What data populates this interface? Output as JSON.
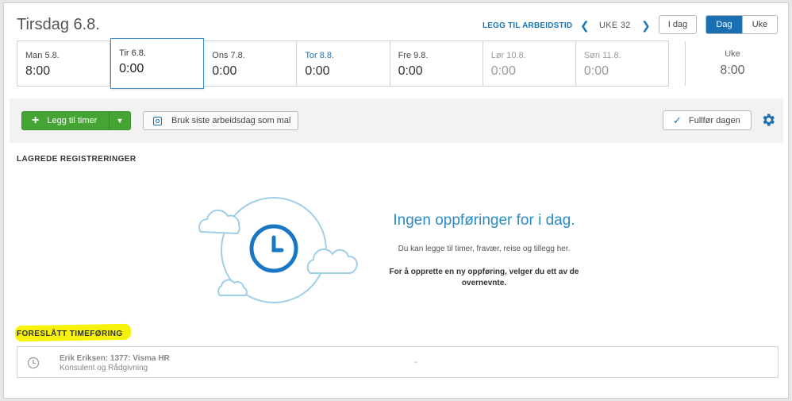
{
  "header": {
    "date_title": "Tirsdag 6.8.",
    "add_worktime": "LEGG TIL ARBEIDSTID",
    "week_label": "UKE 32",
    "today_button": "I dag",
    "view_day": "Dag",
    "view_week": "Uke"
  },
  "days": [
    {
      "name": "Man 5.8.",
      "time": "8:00"
    },
    {
      "name": "Tir 6.8.",
      "time": "0:00"
    },
    {
      "name": "Ons 7.8.",
      "time": "0:00"
    },
    {
      "name": "Tor 8.8.",
      "time": "0:00"
    },
    {
      "name": "Fre 9.8.",
      "time": "0:00"
    },
    {
      "name": "Lør 10.8.",
      "time": "0:00"
    },
    {
      "name": "Søn 11.8.",
      "time": "0:00"
    }
  ],
  "week_total": {
    "label": "Uke",
    "value": "8:00"
  },
  "toolbar": {
    "add_hours": "Legg til timer",
    "use_template": "Bruk siste arbeidsdag som mal",
    "finish_day": "Fullfør dagen"
  },
  "saved": {
    "title": "LAGREDE REGISTRERINGER",
    "empty_heading": "Ingen oppføringer for i dag.",
    "empty_sub": "Du kan legge til timer, fravær, reise og tillegg her.",
    "empty_bold": "For å opprette en ny oppføring, velger du ett av de overnevnte."
  },
  "suggested": {
    "title": "FORESLÅTT TIMEFØRING",
    "line1": "Erik Eriksen: 1377: Visma HR",
    "line2": "Konsulent og Rådgivning",
    "value": "-"
  },
  "colors": {
    "accent": "#1a6fb3",
    "link": "#1a77b9",
    "green": "#45a533",
    "highlight": "#f6f20a",
    "illustration": "#9fcfe8"
  },
  "icons": [
    "chevron-left-icon",
    "chevron-right-icon",
    "plus-icon",
    "caret-down-icon",
    "calendar-icon",
    "checkmark-icon",
    "gear-icon",
    "clock-icon",
    "cloud-icon"
  ]
}
